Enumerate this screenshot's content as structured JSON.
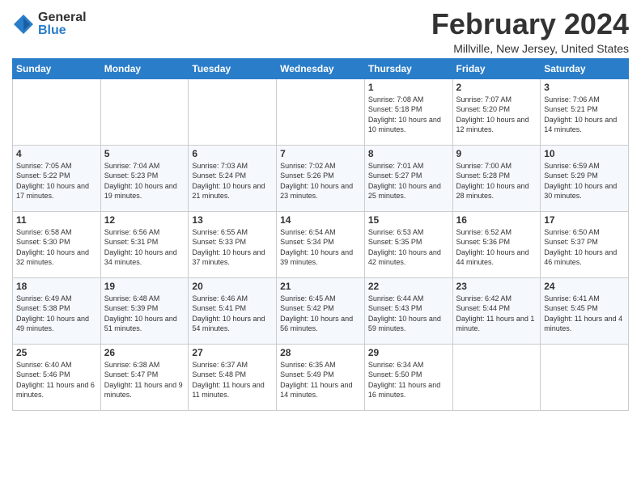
{
  "logo": {
    "general": "General",
    "blue": "Blue"
  },
  "title": "February 2024",
  "subtitle": "Millville, New Jersey, United States",
  "days_of_week": [
    "Sunday",
    "Monday",
    "Tuesday",
    "Wednesday",
    "Thursday",
    "Friday",
    "Saturday"
  ],
  "weeks": [
    [
      {
        "num": "",
        "sunrise": "",
        "sunset": "",
        "daylight": ""
      },
      {
        "num": "",
        "sunrise": "",
        "sunset": "",
        "daylight": ""
      },
      {
        "num": "",
        "sunrise": "",
        "sunset": "",
        "daylight": ""
      },
      {
        "num": "",
        "sunrise": "",
        "sunset": "",
        "daylight": ""
      },
      {
        "num": "1",
        "sunrise": "Sunrise: 7:08 AM",
        "sunset": "Sunset: 5:18 PM",
        "daylight": "Daylight: 10 hours and 10 minutes."
      },
      {
        "num": "2",
        "sunrise": "Sunrise: 7:07 AM",
        "sunset": "Sunset: 5:20 PM",
        "daylight": "Daylight: 10 hours and 12 minutes."
      },
      {
        "num": "3",
        "sunrise": "Sunrise: 7:06 AM",
        "sunset": "Sunset: 5:21 PM",
        "daylight": "Daylight: 10 hours and 14 minutes."
      }
    ],
    [
      {
        "num": "4",
        "sunrise": "Sunrise: 7:05 AM",
        "sunset": "Sunset: 5:22 PM",
        "daylight": "Daylight: 10 hours and 17 minutes."
      },
      {
        "num": "5",
        "sunrise": "Sunrise: 7:04 AM",
        "sunset": "Sunset: 5:23 PM",
        "daylight": "Daylight: 10 hours and 19 minutes."
      },
      {
        "num": "6",
        "sunrise": "Sunrise: 7:03 AM",
        "sunset": "Sunset: 5:24 PM",
        "daylight": "Daylight: 10 hours and 21 minutes."
      },
      {
        "num": "7",
        "sunrise": "Sunrise: 7:02 AM",
        "sunset": "Sunset: 5:26 PM",
        "daylight": "Daylight: 10 hours and 23 minutes."
      },
      {
        "num": "8",
        "sunrise": "Sunrise: 7:01 AM",
        "sunset": "Sunset: 5:27 PM",
        "daylight": "Daylight: 10 hours and 25 minutes."
      },
      {
        "num": "9",
        "sunrise": "Sunrise: 7:00 AM",
        "sunset": "Sunset: 5:28 PM",
        "daylight": "Daylight: 10 hours and 28 minutes."
      },
      {
        "num": "10",
        "sunrise": "Sunrise: 6:59 AM",
        "sunset": "Sunset: 5:29 PM",
        "daylight": "Daylight: 10 hours and 30 minutes."
      }
    ],
    [
      {
        "num": "11",
        "sunrise": "Sunrise: 6:58 AM",
        "sunset": "Sunset: 5:30 PM",
        "daylight": "Daylight: 10 hours and 32 minutes."
      },
      {
        "num": "12",
        "sunrise": "Sunrise: 6:56 AM",
        "sunset": "Sunset: 5:31 PM",
        "daylight": "Daylight: 10 hours and 34 minutes."
      },
      {
        "num": "13",
        "sunrise": "Sunrise: 6:55 AM",
        "sunset": "Sunset: 5:33 PM",
        "daylight": "Daylight: 10 hours and 37 minutes."
      },
      {
        "num": "14",
        "sunrise": "Sunrise: 6:54 AM",
        "sunset": "Sunset: 5:34 PM",
        "daylight": "Daylight: 10 hours and 39 minutes."
      },
      {
        "num": "15",
        "sunrise": "Sunrise: 6:53 AM",
        "sunset": "Sunset: 5:35 PM",
        "daylight": "Daylight: 10 hours and 42 minutes."
      },
      {
        "num": "16",
        "sunrise": "Sunrise: 6:52 AM",
        "sunset": "Sunset: 5:36 PM",
        "daylight": "Daylight: 10 hours and 44 minutes."
      },
      {
        "num": "17",
        "sunrise": "Sunrise: 6:50 AM",
        "sunset": "Sunset: 5:37 PM",
        "daylight": "Daylight: 10 hours and 46 minutes."
      }
    ],
    [
      {
        "num": "18",
        "sunrise": "Sunrise: 6:49 AM",
        "sunset": "Sunset: 5:38 PM",
        "daylight": "Daylight: 10 hours and 49 minutes."
      },
      {
        "num": "19",
        "sunrise": "Sunrise: 6:48 AM",
        "sunset": "Sunset: 5:39 PM",
        "daylight": "Daylight: 10 hours and 51 minutes."
      },
      {
        "num": "20",
        "sunrise": "Sunrise: 6:46 AM",
        "sunset": "Sunset: 5:41 PM",
        "daylight": "Daylight: 10 hours and 54 minutes."
      },
      {
        "num": "21",
        "sunrise": "Sunrise: 6:45 AM",
        "sunset": "Sunset: 5:42 PM",
        "daylight": "Daylight: 10 hours and 56 minutes."
      },
      {
        "num": "22",
        "sunrise": "Sunrise: 6:44 AM",
        "sunset": "Sunset: 5:43 PM",
        "daylight": "Daylight: 10 hours and 59 minutes."
      },
      {
        "num": "23",
        "sunrise": "Sunrise: 6:42 AM",
        "sunset": "Sunset: 5:44 PM",
        "daylight": "Daylight: 11 hours and 1 minute."
      },
      {
        "num": "24",
        "sunrise": "Sunrise: 6:41 AM",
        "sunset": "Sunset: 5:45 PM",
        "daylight": "Daylight: 11 hours and 4 minutes."
      }
    ],
    [
      {
        "num": "25",
        "sunrise": "Sunrise: 6:40 AM",
        "sunset": "Sunset: 5:46 PM",
        "daylight": "Daylight: 11 hours and 6 minutes."
      },
      {
        "num": "26",
        "sunrise": "Sunrise: 6:38 AM",
        "sunset": "Sunset: 5:47 PM",
        "daylight": "Daylight: 11 hours and 9 minutes."
      },
      {
        "num": "27",
        "sunrise": "Sunrise: 6:37 AM",
        "sunset": "Sunset: 5:48 PM",
        "daylight": "Daylight: 11 hours and 11 minutes."
      },
      {
        "num": "28",
        "sunrise": "Sunrise: 6:35 AM",
        "sunset": "Sunset: 5:49 PM",
        "daylight": "Daylight: 11 hours and 14 minutes."
      },
      {
        "num": "29",
        "sunrise": "Sunrise: 6:34 AM",
        "sunset": "Sunset: 5:50 PM",
        "daylight": "Daylight: 11 hours and 16 minutes."
      },
      {
        "num": "",
        "sunrise": "",
        "sunset": "",
        "daylight": ""
      },
      {
        "num": "",
        "sunrise": "",
        "sunset": "",
        "daylight": ""
      }
    ]
  ]
}
